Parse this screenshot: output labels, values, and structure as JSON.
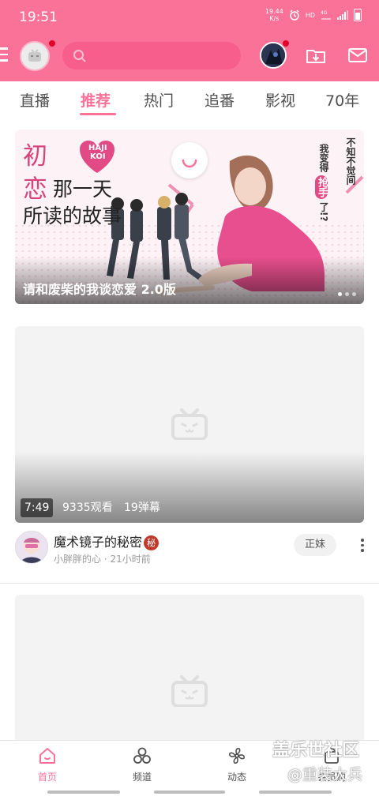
{
  "status_bar": {
    "time": "19:51",
    "net_speed_value": "19.44",
    "net_speed_unit": "K/s",
    "hd_label": "HD",
    "network_label": "4G"
  },
  "header": {
    "search_placeholder": ""
  },
  "tabs": [
    {
      "label": "直播",
      "active": false
    },
    {
      "label": "推荐",
      "active": true
    },
    {
      "label": "热门",
      "active": false
    },
    {
      "label": "追番",
      "active": false
    },
    {
      "label": "影视",
      "active": false
    },
    {
      "label": "70年",
      "active": false
    }
  ],
  "banner": {
    "caption": "请和废柴的我谈恋爱 2.0版",
    "artwork_text": {
      "line1_char": "初",
      "line2_char": "恋",
      "line2_rest": "那一天",
      "line3": "所读的故事",
      "heart_line1": "HAJI",
      "heart_line2": "KOI",
      "vertical_1": "我变得",
      "vertical_highlight": "抢手",
      "vertical_2": "了!?",
      "vertical_3": "不知不觉间"
    },
    "page_count": 3,
    "active_page": 1
  },
  "videos": [
    {
      "duration": "7:49",
      "views": "9335观看",
      "danmaku": "19弹幕",
      "title": "魔术镜子的秘密",
      "badge": "秘",
      "uploader_line": "小胖胖的心 · 21小时前",
      "tag": "正妹"
    },
    {
      "duration": "",
      "views": "",
      "danmaku": "",
      "title": "",
      "uploader_line": "",
      "tag": ""
    }
  ],
  "bottom_nav": [
    {
      "label": "首页",
      "icon": "home-icon",
      "active": true
    },
    {
      "label": "频道",
      "icon": "channel-icon",
      "active": false
    },
    {
      "label": "动态",
      "icon": "activity-icon",
      "active": false
    },
    {
      "label": "会员购",
      "icon": "shop-icon",
      "active": false
    }
  ],
  "watermark": {
    "line1": "盖乐世社区",
    "line2": "@重装大兵"
  },
  "colors": {
    "brand_pink": "#fb7299",
    "text": "#212121",
    "muted": "#999999"
  }
}
